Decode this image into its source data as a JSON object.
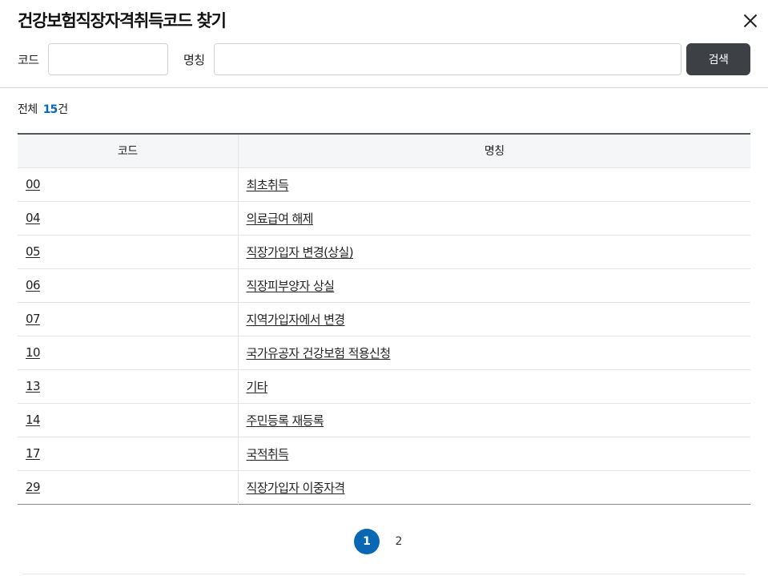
{
  "dialog": {
    "title": "건강보험직장자격취득코드 찾기"
  },
  "search": {
    "code_label": "코드",
    "code_value": "",
    "name_label": "명칭",
    "name_value": "",
    "button_label": "검색"
  },
  "summary": {
    "prefix": "전체",
    "count": "15",
    "suffix": "건"
  },
  "table": {
    "headers": [
      "코드",
      "명칭"
    ],
    "rows": [
      {
        "code": "00",
        "name": "최초취득"
      },
      {
        "code": "04",
        "name": "의료급여 해제"
      },
      {
        "code": "05",
        "name": "직장가입자 변경(상실)"
      },
      {
        "code": "06",
        "name": "직장피부양자 상실"
      },
      {
        "code": "07",
        "name": "지역가입자에서 변경"
      },
      {
        "code": "10",
        "name": "국가유공자 건강보험 적용신청"
      },
      {
        "code": "13",
        "name": "기타"
      },
      {
        "code": "14",
        "name": "주민등록 재등록"
      },
      {
        "code": "17",
        "name": "국적취득"
      },
      {
        "code": "29",
        "name": "직장가입자 이중자격"
      }
    ]
  },
  "pagination": {
    "pages": [
      "1",
      "2"
    ],
    "current": "1"
  },
  "colors": {
    "accent": "#0a67b3",
    "search_button": "#3d4044"
  },
  "icons": {
    "close": "close-icon"
  }
}
